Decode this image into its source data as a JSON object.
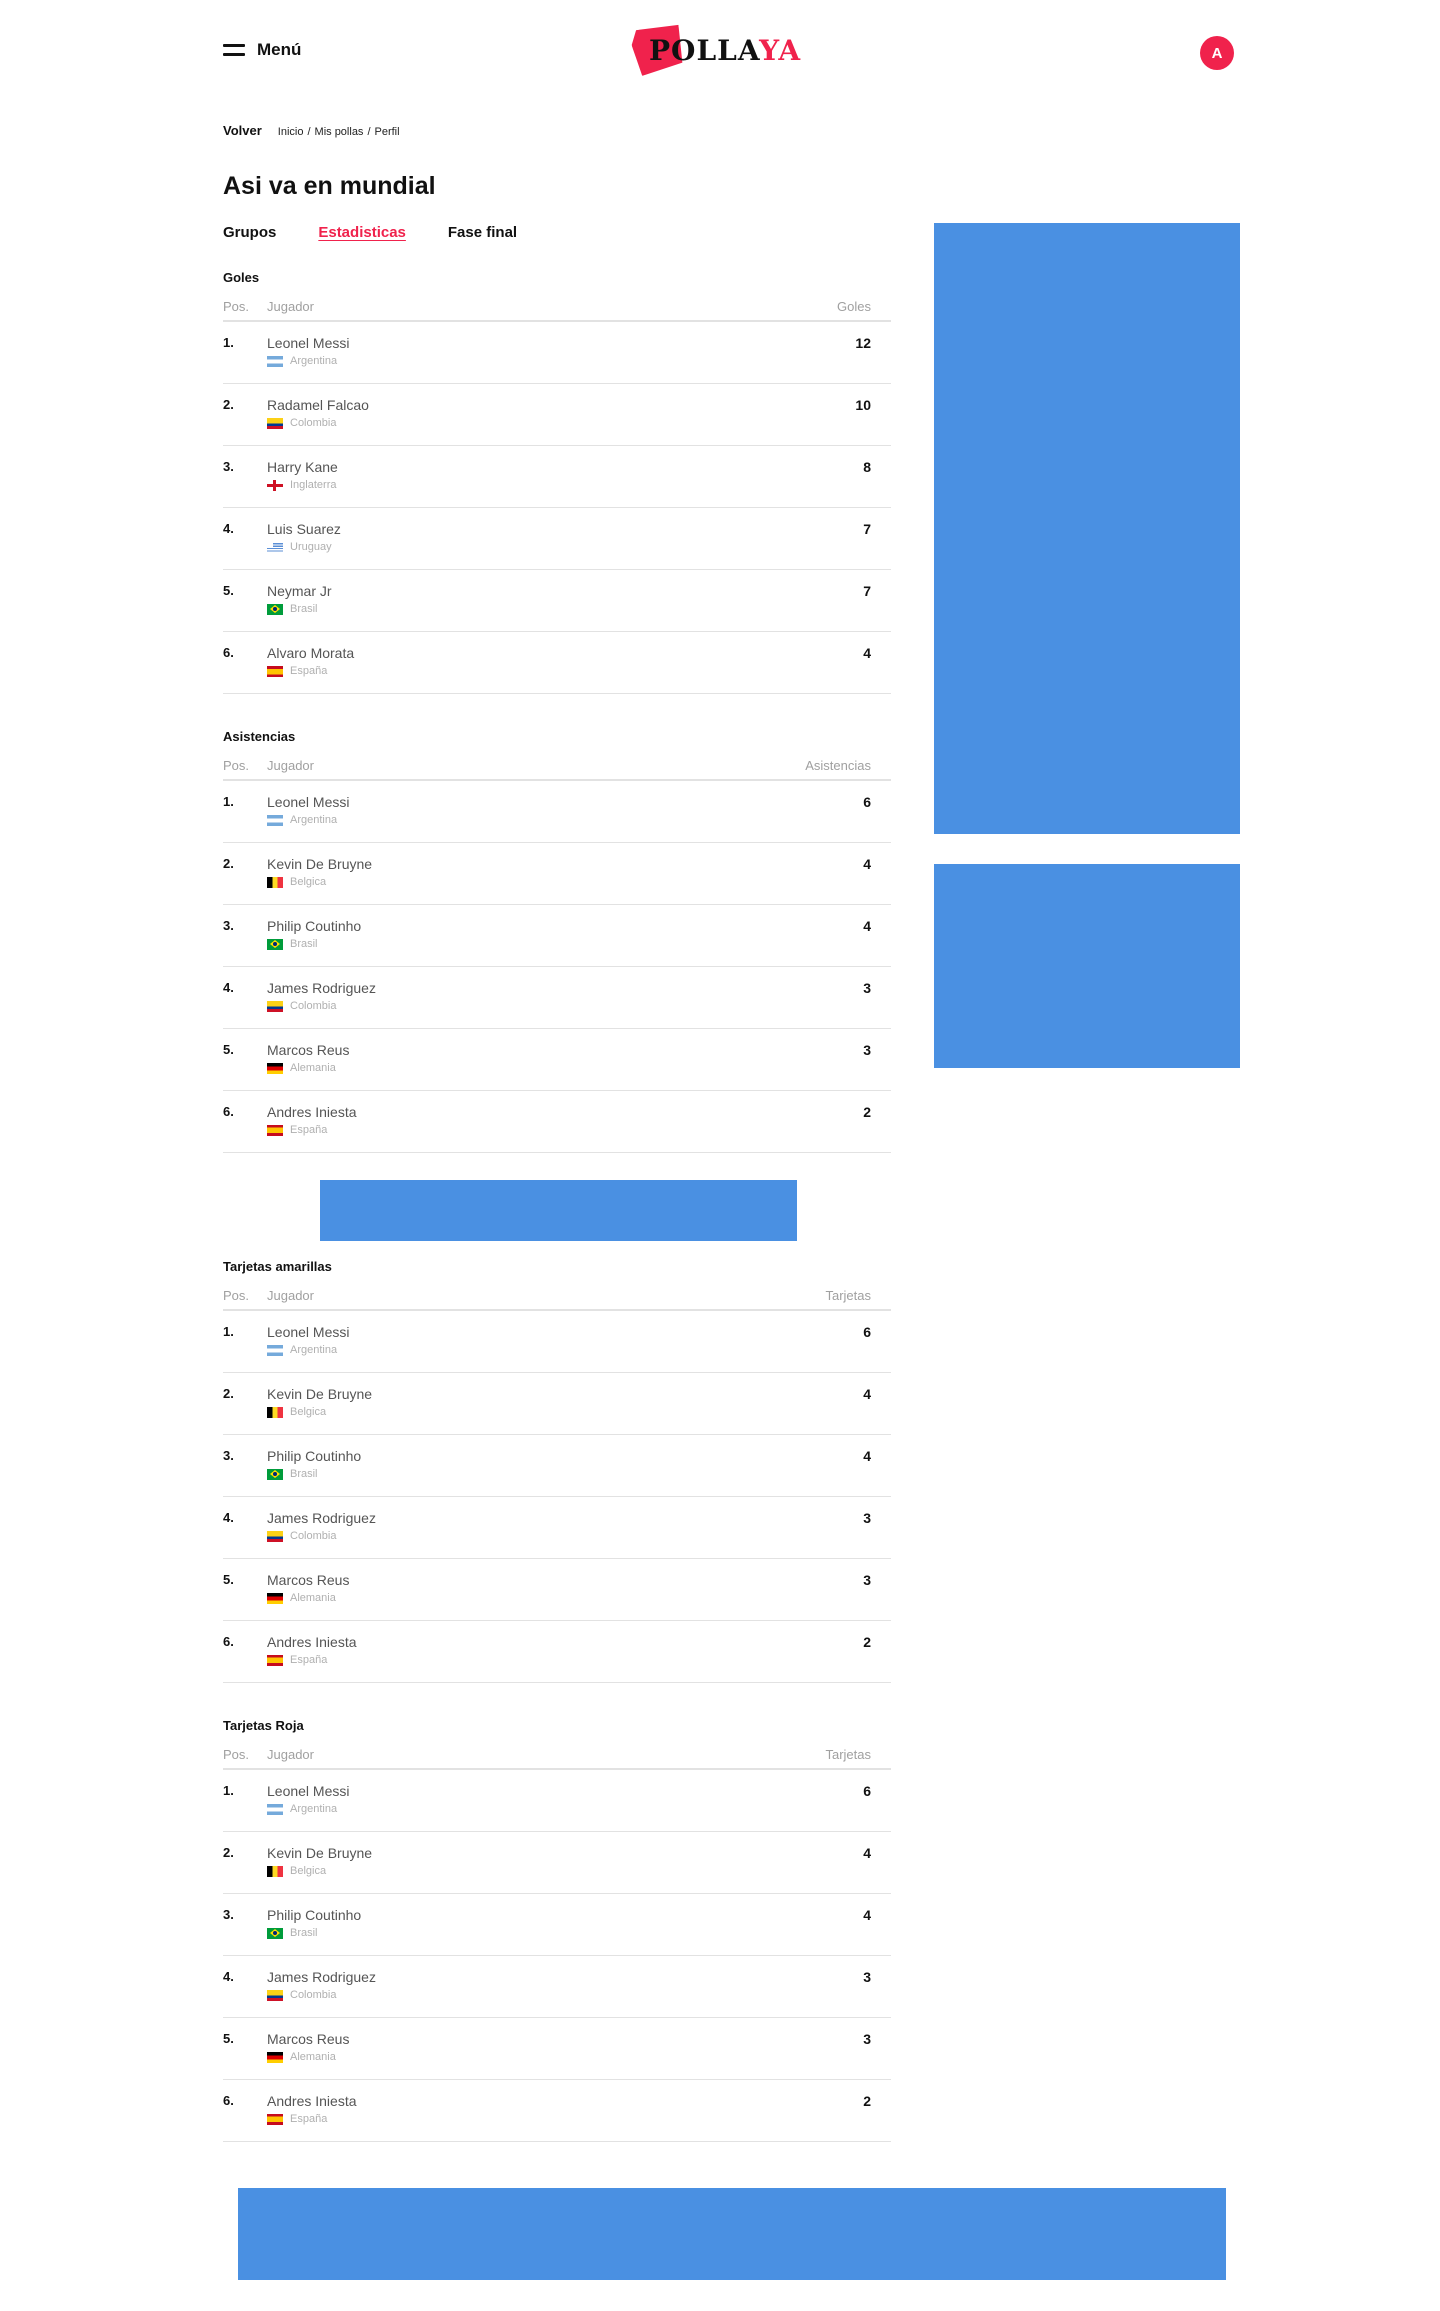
{
  "header": {
    "menu_label": "Menú",
    "logo_text_main": "POLLA",
    "logo_text_accent": "YA",
    "avatar_initial": "A",
    "brand_color": "#f0224c"
  },
  "breadcrumb": {
    "back_label": "Volver",
    "items": [
      "Inicio",
      "Mis pollas",
      "Perfil"
    ],
    "separator": "/"
  },
  "page": {
    "title": "Asi va en mundial",
    "tabs": [
      {
        "label": "Grupos",
        "active": false
      },
      {
        "label": "Estadisticas",
        "active": true
      },
      {
        "label": "Fase final",
        "active": false
      }
    ]
  },
  "stats": [
    {
      "title": "Goles",
      "col_pos": "Pos.",
      "col_player": "Jugador",
      "col_value": "Goles",
      "rows": [
        {
          "pos": "1.",
          "name": "Leonel Messi",
          "country": "Argentina",
          "flag": "argentina",
          "value": "12"
        },
        {
          "pos": "2.",
          "name": "Radamel Falcao",
          "country": "Colombia",
          "flag": "colombia",
          "value": "10"
        },
        {
          "pos": "3.",
          "name": "Harry Kane",
          "country": "Inglaterra",
          "flag": "inglaterra",
          "value": "8"
        },
        {
          "pos": "4.",
          "name": "Luis Suarez",
          "country": "Uruguay",
          "flag": "uruguay",
          "value": "7"
        },
        {
          "pos": "5.",
          "name": "Neymar Jr",
          "country": "Brasil",
          "flag": "brasil",
          "value": "7"
        },
        {
          "pos": "6.",
          "name": "Alvaro Morata",
          "country": "España",
          "flag": "espana",
          "value": "4"
        }
      ]
    },
    {
      "title": "Asistencias",
      "col_pos": "Pos.",
      "col_player": "Jugador",
      "col_value": "Asistencias",
      "rows": [
        {
          "pos": "1.",
          "name": "Leonel Messi",
          "country": "Argentina",
          "flag": "argentina",
          "value": "6"
        },
        {
          "pos": "2.",
          "name": "Kevin De Bruyne",
          "country": "Belgica",
          "flag": "belgica",
          "value": "4"
        },
        {
          "pos": "3.",
          "name": "Philip Coutinho",
          "country": "Brasil",
          "flag": "brasil",
          "value": "4"
        },
        {
          "pos": "4.",
          "name": "James Rodriguez",
          "country": "Colombia",
          "flag": "colombia",
          "value": "3"
        },
        {
          "pos": "5.",
          "name": "Marcos Reus",
          "country": "Alemania",
          "flag": "alemania",
          "value": "3"
        },
        {
          "pos": "6.",
          "name": "Andres Iniesta",
          "country": "España",
          "flag": "espana",
          "value": "2"
        }
      ]
    },
    {
      "title": "Tarjetas amarillas",
      "col_pos": "Pos.",
      "col_player": "Jugador",
      "col_value": "Tarjetas",
      "rows": [
        {
          "pos": "1.",
          "name": "Leonel Messi",
          "country": "Argentina",
          "flag": "argentina",
          "value": "6"
        },
        {
          "pos": "2.",
          "name": "Kevin De Bruyne",
          "country": "Belgica",
          "flag": "belgica",
          "value": "4"
        },
        {
          "pos": "3.",
          "name": "Philip Coutinho",
          "country": "Brasil",
          "flag": "brasil",
          "value": "4"
        },
        {
          "pos": "4.",
          "name": "James Rodriguez",
          "country": "Colombia",
          "flag": "colombia",
          "value": "3"
        },
        {
          "pos": "5.",
          "name": "Marcos Reus",
          "country": "Alemania",
          "flag": "alemania",
          "value": "3"
        },
        {
          "pos": "6.",
          "name": "Andres Iniesta",
          "country": "España",
          "flag": "espana",
          "value": "2"
        }
      ]
    },
    {
      "title": "Tarjetas Roja",
      "col_pos": "Pos.",
      "col_player": "Jugador",
      "col_value": "Tarjetas",
      "rows": [
        {
          "pos": "1.",
          "name": "Leonel Messi",
          "country": "Argentina",
          "flag": "argentina",
          "value": "6"
        },
        {
          "pos": "2.",
          "name": "Kevin De Bruyne",
          "country": "Belgica",
          "flag": "belgica",
          "value": "4"
        },
        {
          "pos": "3.",
          "name": "Philip Coutinho",
          "country": "Brasil",
          "flag": "brasil",
          "value": "4"
        },
        {
          "pos": "4.",
          "name": "James Rodriguez",
          "country": "Colombia",
          "flag": "colombia",
          "value": "3"
        },
        {
          "pos": "5.",
          "name": "Marcos Reus",
          "country": "Alemania",
          "flag": "alemania",
          "value": "3"
        },
        {
          "pos": "6.",
          "name": "Andres Iniesta",
          "country": "España",
          "flag": "espana",
          "value": "2"
        }
      ]
    }
  ],
  "ads": {
    "placeholder_color": "#4a90e2"
  }
}
